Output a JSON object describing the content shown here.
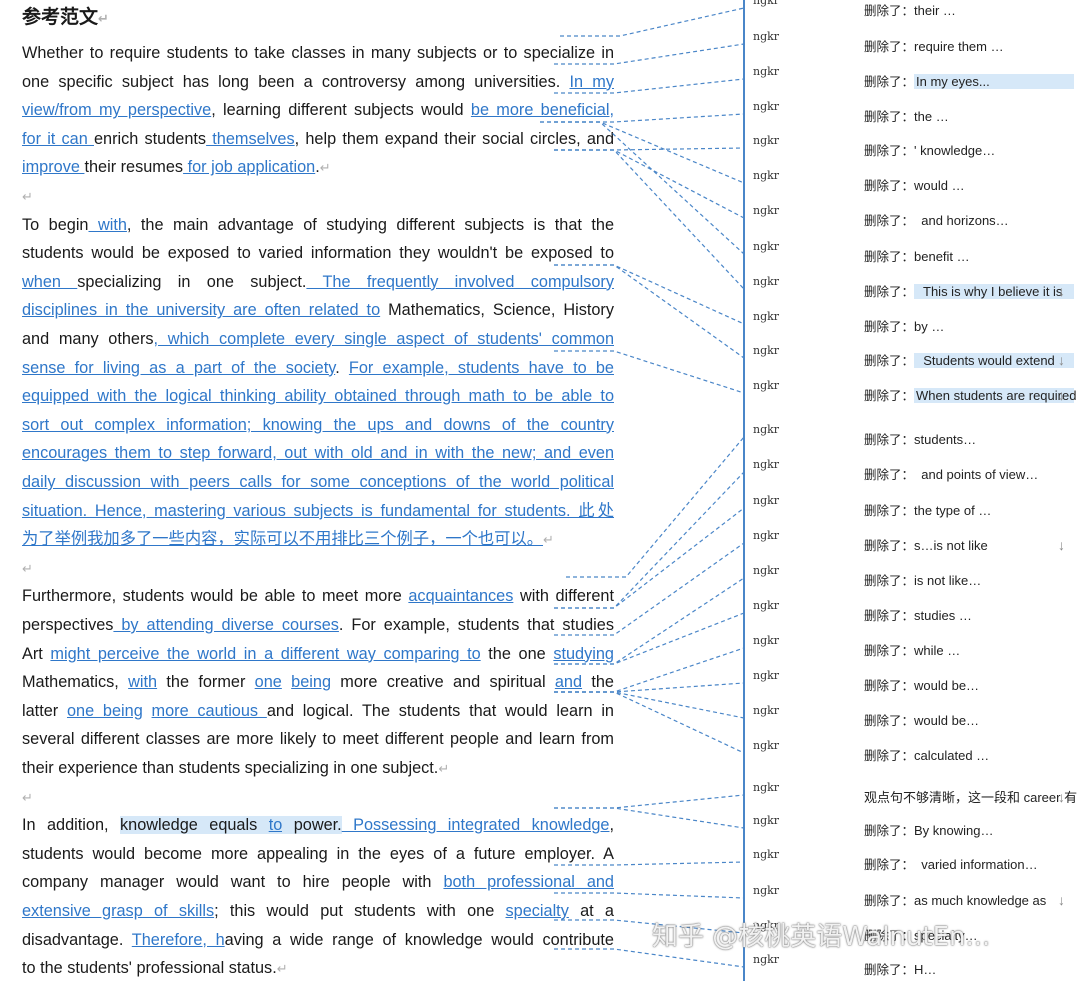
{
  "document": {
    "title": "参考范文",
    "paragraph_mark": "↵",
    "paragraphs": [
      [
        [
          [
            "Whether to require students to take classes in many subjects or to specialize in",
            ""
          ]
        ],
        [
          [
            "one specific subject has long been a controversy among universities. ",
            ""
          ],
          [
            "In my",
            "ins"
          ]
        ],
        [
          [
            "view/from my perspective",
            "ins"
          ],
          [
            ", learning different subjects would ",
            ""
          ],
          [
            "be more beneficial,",
            "ins"
          ]
        ],
        [
          [
            "for it can ",
            "ins"
          ],
          [
            "enrich students",
            ""
          ],
          [
            " themselves",
            "ins"
          ],
          [
            ", help them expand their social circles, and",
            ""
          ]
        ],
        [
          [
            "improve ",
            "ins"
          ],
          [
            "their resumes",
            ""
          ],
          [
            " for job application",
            "ins"
          ],
          [
            ".",
            ""
          ]
        ]
      ],
      [],
      [
        [
          [
            "To begin",
            ""
          ],
          [
            " with",
            "ins"
          ],
          [
            ", the main advantage of studying different subjects is that the",
            ""
          ]
        ],
        [
          [
            "students would be exposed to varied information they wouldn't be exposed to",
            ""
          ]
        ],
        [
          [
            "when ",
            "ins"
          ],
          [
            " specializing in one subject.",
            ""
          ],
          [
            " The frequently involved compulsory",
            "ins"
          ]
        ],
        [
          [
            "disciplines in the university are often related to",
            "ins"
          ],
          [
            " Mathematics, Science, History",
            ""
          ]
        ],
        [
          [
            "and many others",
            ""
          ],
          [
            ", which complete every single aspect of students' common",
            "ins"
          ]
        ],
        [
          [
            "sense for living as a part of the society",
            "ins"
          ],
          [
            ". ",
            ""
          ],
          [
            "For example, students have to be",
            "ins"
          ]
        ],
        [
          [
            "equipped with the logical thinking ability obtained through math to be able to",
            "ins"
          ]
        ],
        [
          [
            "sort out complex information; knowing the ups and downs of the country",
            "ins"
          ]
        ],
        [
          [
            "encourages them to step forward, out with old and in with the new; and even",
            "ins"
          ]
        ],
        [
          [
            "daily discussion with peers calls for some conceptions of the world political",
            "ins"
          ]
        ],
        [
          [
            "situation. Hence, mastering various subjects is fundamental for students. 此处",
            "ins"
          ]
        ],
        [
          [
            "为了举例我加多了一些内容，实际可以不用排比三个例子，一个也可以。",
            "ins"
          ]
        ]
      ],
      [],
      [
        [
          [
            "Furthermore, students would be able to meet more ",
            ""
          ],
          [
            "acquaintances",
            "ins"
          ],
          [
            " with different",
            ""
          ]
        ],
        [
          [
            "perspectives",
            ""
          ],
          [
            " by attending diverse courses",
            "ins"
          ],
          [
            ". For example, students that studies",
            ""
          ]
        ],
        [
          [
            "Art ",
            ""
          ],
          [
            "might perceive the world in a different way comparing to",
            "ins"
          ],
          [
            " the one ",
            ""
          ],
          [
            "studying",
            "ins"
          ]
        ],
        [
          [
            "Mathematics, ",
            ""
          ],
          [
            "with",
            "ins"
          ],
          [
            " the former ",
            ""
          ],
          [
            "one",
            "ins"
          ],
          [
            " ",
            ""
          ],
          [
            "being",
            "ins"
          ],
          [
            " more creative and spiritual ",
            ""
          ],
          [
            "and",
            "ins"
          ],
          [
            " the",
            ""
          ]
        ],
        [
          [
            "latter ",
            ""
          ],
          [
            "one being",
            "ins"
          ],
          [
            " ",
            ""
          ],
          [
            "more cautious ",
            "ins"
          ],
          [
            "and logical. The students that would learn in",
            ""
          ]
        ],
        [
          [
            "several different classes are more likely to meet different people and learn from",
            ""
          ]
        ],
        [
          [
            "their experience than students specializing in one subject.",
            ""
          ]
        ]
      ],
      [],
      [
        [
          [
            "In addition, ",
            ""
          ],
          [
            "knowledge equals ",
            "hl"
          ],
          [
            "to",
            "ins hl"
          ],
          [
            " power.",
            "hl"
          ],
          [
            " Possessing integrated knowledge",
            "ins"
          ],
          [
            ",",
            ""
          ]
        ],
        [
          [
            "students would become more appealing in the eyes of a future employer. A",
            ""
          ]
        ],
        [
          [
            "company manager would want to hire people with ",
            ""
          ],
          [
            "both professional and",
            "ins"
          ]
        ],
        [
          [
            "extensive grasp of skills",
            "ins"
          ],
          [
            "; this would put students with one ",
            ""
          ],
          [
            "specialty",
            "ins"
          ],
          [
            " at a",
            ""
          ]
        ],
        [
          [
            "disadvantage. ",
            ""
          ],
          [
            "Therefore, h",
            "ins"
          ],
          [
            "aving a wide range of knowledge would contribute",
            ""
          ]
        ],
        [
          [
            "to the students' professional status.",
            ""
          ]
        ]
      ]
    ]
  },
  "comments": {
    "accent_color": "#4a86c8",
    "items": [
      {
        "author": "ngkr",
        "prefix": "删除了：",
        "text": "their …",
        "hl": false,
        "arrow": false
      },
      {
        "author": "ngkr",
        "prefix": "删除了：",
        "text": "require them …",
        "hl": false,
        "arrow": false
      },
      {
        "author": "ngkr",
        "prefix": "删除了：",
        "text": "In my eyes...",
        "hl": true,
        "arrow": false
      },
      {
        "author": "ngkr",
        "prefix": "删除了：",
        "text": "the …",
        "hl": false,
        "arrow": false
      },
      {
        "author": "ngkr",
        "prefix": "删除了：",
        "text": "' knowledge…",
        "hl": false,
        "arrow": false
      },
      {
        "author": "ngkr",
        "prefix": "删除了：",
        "text": "would …",
        "hl": false,
        "arrow": false
      },
      {
        "author": "ngkr",
        "prefix": "删除了：",
        "text": "  and horizons…",
        "hl": false,
        "arrow": false
      },
      {
        "author": "ngkr",
        "prefix": "删除了：",
        "text": "benefit …",
        "hl": false,
        "arrow": false
      },
      {
        "author": "ngkr",
        "prefix": "删除了：",
        "text": "  This is why I believe it is",
        "hl": true,
        "arrow": true
      },
      {
        "author": "ngkr",
        "prefix": "删除了：",
        "text": "by …",
        "hl": false,
        "arrow": false
      },
      {
        "author": "ngkr",
        "prefix": "删除了：",
        "text": "  Students would extend",
        "hl": true,
        "arrow": true
      },
      {
        "author": "ngkr",
        "prefix": "删除了：",
        "text": "When students are required",
        "hl": true,
        "arrow": true
      },
      {
        "author": "ngkr",
        "prefix": "删除了：",
        "text": "students…",
        "hl": false,
        "arrow": false
      },
      {
        "author": "ngkr",
        "prefix": "删除了：",
        "text": "  and points of view…",
        "hl": false,
        "arrow": false
      },
      {
        "author": "ngkr",
        "prefix": "删除了：",
        "text": "the type of …",
        "hl": false,
        "arrow": false
      },
      {
        "author": "ngkr",
        "prefix": "删除了：",
        "text": "s…is not like",
        "hl": false,
        "arrow": true
      },
      {
        "author": "ngkr",
        "prefix": "删除了：",
        "text": "is not like…",
        "hl": false,
        "arrow": false
      },
      {
        "author": "ngkr",
        "prefix": "删除了：",
        "text": "studies …",
        "hl": false,
        "arrow": false
      },
      {
        "author": "ngkr",
        "prefix": "删除了：",
        "text": "while …",
        "hl": false,
        "arrow": false
      },
      {
        "author": "ngkr",
        "prefix": "删除了：",
        "text": "would be…",
        "hl": false,
        "arrow": false
      },
      {
        "author": "ngkr",
        "prefix": "删除了：",
        "text": "would be…",
        "hl": false,
        "arrow": false
      },
      {
        "author": "ngkr",
        "prefix": "删除了：",
        "text": "calculated …",
        "hl": false,
        "arrow": false
      },
      {
        "author": "ngkr",
        "prefix": "",
        "text": "观点句不够清晰，这一段和 career 有",
        "hl": false,
        "arrow": true
      },
      {
        "author": "ngkr",
        "prefix": "删除了：",
        "text": "By knowing…",
        "hl": false,
        "arrow": false
      },
      {
        "author": "ngkr",
        "prefix": "删除了：",
        "text": "  varied information…",
        "hl": false,
        "arrow": false
      },
      {
        "author": "ngkr",
        "prefix": "删除了：",
        "text": "as much knowledge as",
        "hl": false,
        "arrow": true
      },
      {
        "author": "ngkr",
        "prefix": "删除了：",
        "text": "specialty…",
        "hl": false,
        "arrow": false
      },
      {
        "author": "ngkr",
        "prefix": "删除了：",
        "text": "H…",
        "hl": false,
        "arrow": false
      }
    ],
    "arrow_glyph": "↓"
  },
  "watermark": "知乎 @核桃英语WalnutEn..."
}
